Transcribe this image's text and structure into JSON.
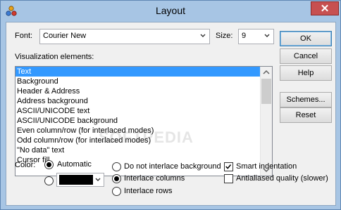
{
  "window": {
    "title": "Layout",
    "close_glyph": "✕"
  },
  "font": {
    "label": "Font:",
    "value": "Courier New",
    "size_label": "Size:",
    "size_value": "9"
  },
  "list": {
    "label": "Visualization elements:",
    "items": [
      "Text",
      "Background",
      "Header & Address",
      "Address background",
      "ASCII/UNICODE text",
      "ASCII/UNICODE background",
      "Even column/row (for interlaced modes)",
      "Odd column/row (for interlaced modes)",
      "\"No data\" text",
      "Cursor fill"
    ],
    "selected_index": 0
  },
  "buttons": {
    "ok": "OK",
    "cancel": "Cancel",
    "help": "Help",
    "schemes": "Schemes...",
    "reset": "Reset"
  },
  "color": {
    "label": "Color:",
    "automatic": "Automatic",
    "automatic_selected": true,
    "custom_value": "#000000"
  },
  "interlace": {
    "none": "Do not interlace background",
    "columns": "Interlace columns",
    "rows": "Interlace rows",
    "selected": "columns"
  },
  "options": {
    "smart_indentation": "Smart indentation",
    "smart_indentation_checked": true,
    "antialiased": "Antialiased quality (slower)",
    "antialiased_checked": false
  },
  "watermark": "SOFTPEDIA"
}
